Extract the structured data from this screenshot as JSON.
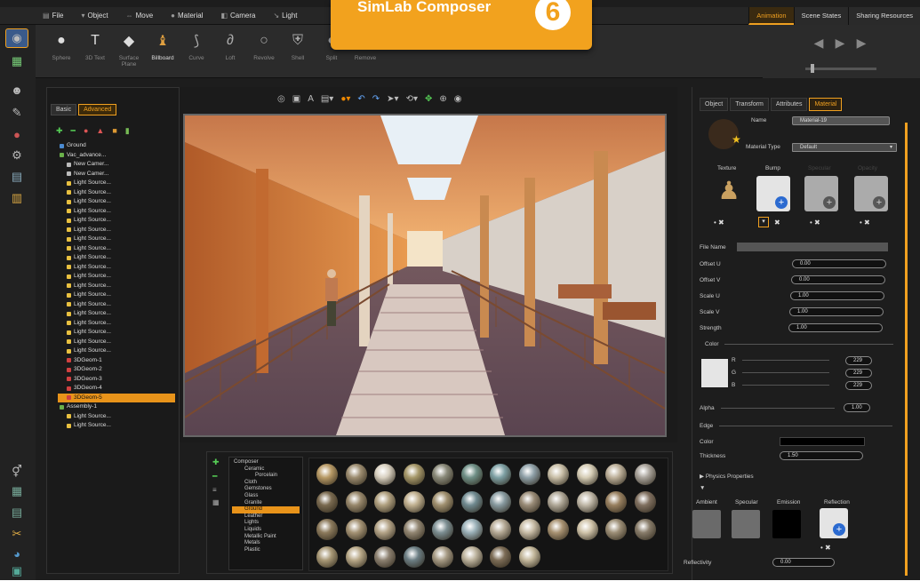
{
  "banner": {
    "title": "SimLab Composer",
    "version": "6"
  },
  "menu": [
    {
      "icon": "file-icon",
      "glyph": "▤",
      "label": "File"
    },
    {
      "icon": "object-icon",
      "glyph": "▾",
      "label": "Object"
    },
    {
      "icon": "move-icon",
      "glyph": "⇔",
      "label": "Move"
    },
    {
      "icon": "material-icon",
      "glyph": "●",
      "label": "Material"
    },
    {
      "icon": "camera-icon",
      "glyph": "◧",
      "label": "Camera"
    },
    {
      "icon": "light-icon",
      "glyph": "↘",
      "label": "Light"
    }
  ],
  "right_tabs": [
    "Animation",
    "Scene States",
    "Sharing Resources"
  ],
  "toolbar": {
    "tools": [
      "Sphere",
      "3D Text",
      "Surface Plane",
      "Billboard",
      "Curve",
      "Loft",
      "Revolve",
      "Shell",
      "Split",
      "Remove"
    ],
    "active": "Billboard"
  },
  "left_panel": {
    "tabs": [
      "Basic",
      "Advanced"
    ],
    "active_tab": "Advanced",
    "tree": [
      {
        "label": "Ground",
        "type": "ground",
        "indent": 0
      },
      {
        "label": "Vac_advance...",
        "type": "group",
        "indent": 0
      },
      {
        "label": "New Camer...",
        "type": "camera",
        "indent": 1
      },
      {
        "label": "New Camer...",
        "type": "camera",
        "indent": 1
      },
      {
        "label": "Light Source...",
        "type": "light",
        "indent": 1
      },
      {
        "label": "Light Source...",
        "type": "light",
        "indent": 1
      },
      {
        "label": "Light Source...",
        "type": "light",
        "indent": 1
      },
      {
        "label": "Light Source...",
        "type": "light",
        "indent": 1
      },
      {
        "label": "Light Source...",
        "type": "light",
        "indent": 1
      },
      {
        "label": "Light Source...",
        "type": "light",
        "indent": 1
      },
      {
        "label": "Light Source...",
        "type": "light",
        "indent": 1
      },
      {
        "label": "Light Source...",
        "type": "light",
        "indent": 1
      },
      {
        "label": "Light Source...",
        "type": "light",
        "indent": 1
      },
      {
        "label": "Light Source...",
        "type": "light",
        "indent": 1
      },
      {
        "label": "Light Source...",
        "type": "light",
        "indent": 1
      },
      {
        "label": "Light Source...",
        "type": "light",
        "indent": 1
      },
      {
        "label": "Light Source...",
        "type": "light",
        "indent": 1
      },
      {
        "label": "Light Source...",
        "type": "light",
        "indent": 1
      },
      {
        "label": "Light Source...",
        "type": "light",
        "indent": 1
      },
      {
        "label": "Light Source...",
        "type": "light",
        "indent": 1
      },
      {
        "label": "Light Source...",
        "type": "light",
        "indent": 1
      },
      {
        "label": "Light Source...",
        "type": "light",
        "indent": 1
      },
      {
        "label": "Light Source...",
        "type": "light",
        "indent": 1
      },
      {
        "label": "3DGeom-1",
        "type": "geom",
        "indent": 1
      },
      {
        "label": "3DGeom-2",
        "type": "geom",
        "indent": 1
      },
      {
        "label": "3DGeom-3",
        "type": "geom",
        "indent": 1
      },
      {
        "label": "3DGeom-4",
        "type": "geom",
        "indent": 1
      },
      {
        "label": "3DGeom-5",
        "type": "geom",
        "indent": 1,
        "selected": true
      },
      {
        "label": "Assembly-1",
        "type": "group",
        "indent": 0
      },
      {
        "label": "Light Source...",
        "type": "light",
        "indent": 1
      },
      {
        "label": "Light Source...",
        "type": "light",
        "indent": 1
      }
    ]
  },
  "material_library": {
    "categories": [
      "Composer",
      "Ceramic",
      "Porcelain",
      "Cloth",
      "Gemstones",
      "Glass",
      "Granite",
      "Ground",
      "Leather",
      "Lights",
      "Liquids",
      "Metallic Paint",
      "Metals",
      "Plastic"
    ],
    "selected": "Ground",
    "swatch_colors": [
      "#b89a66",
      "#9c8c70",
      "#d8d0c0",
      "#a6986a",
      "#8a8a7a",
      "#6f8f86",
      "#7ea0a4",
      "#8fa0a8",
      "#c9bfa8",
      "#d6cdb6",
      "#bdb09a",
      "#a8a29a",
      "#7a6a50",
      "#98886c",
      "#b0a080",
      "#c0b090",
      "#a09070",
      "#708a90",
      "#889aa0",
      "#9a8c78",
      "#b0a898",
      "#c0b8a8",
      "#988060",
      "#807060",
      "#8c7a5c",
      "#a49274",
      "#b4a488",
      "#928672",
      "#7c8e92",
      "#9ab0b8",
      "#b6aa96",
      "#c8bca6",
      "#a89272",
      "#d0c4aa",
      "#9c8e76",
      "#887c6a",
      "#a89876",
      "#b8a888",
      "#8c8070",
      "#6c7e84",
      "#a69a84",
      "#bcb29c",
      "#7c6c56",
      "#c4b89c"
    ]
  },
  "right_panel": {
    "tabs": [
      "Object",
      "Transform",
      "Attributes",
      "Material"
    ],
    "active_tab": "Material",
    "name_label": "Name",
    "name_value": "Material-19",
    "material_type_label": "Material Type",
    "material_type_value": "Default",
    "texture_headers": [
      "Texture",
      "Bump",
      "Specular",
      "Opacity"
    ],
    "file_name_label": "File Name",
    "params": [
      {
        "label": "Offset U",
        "value": "0.00"
      },
      {
        "label": "Offset V",
        "value": "0.00"
      },
      {
        "label": "Scale U",
        "value": "1.00"
      },
      {
        "label": "Scale V",
        "value": "1.00"
      },
      {
        "label": "Strength",
        "value": "1.00"
      }
    ],
    "color_label": "Color",
    "rgb": [
      {
        "label": "R",
        "value": "229"
      },
      {
        "label": "G",
        "value": "229"
      },
      {
        "label": "B",
        "value": "229"
      }
    ],
    "alpha_label": "Alpha",
    "alpha_value": "1.00",
    "edge_label": "Edge",
    "edge_color_label": "Color",
    "thickness_label": "Thickness",
    "thickness_value": "1.50",
    "physics_label": "Physics Properties",
    "physics_headers": [
      "Ambient",
      "Specular",
      "Emission",
      "Reflection"
    ],
    "reflectivity_label": "Reflectivity",
    "reflectivity_value": "0.00"
  }
}
